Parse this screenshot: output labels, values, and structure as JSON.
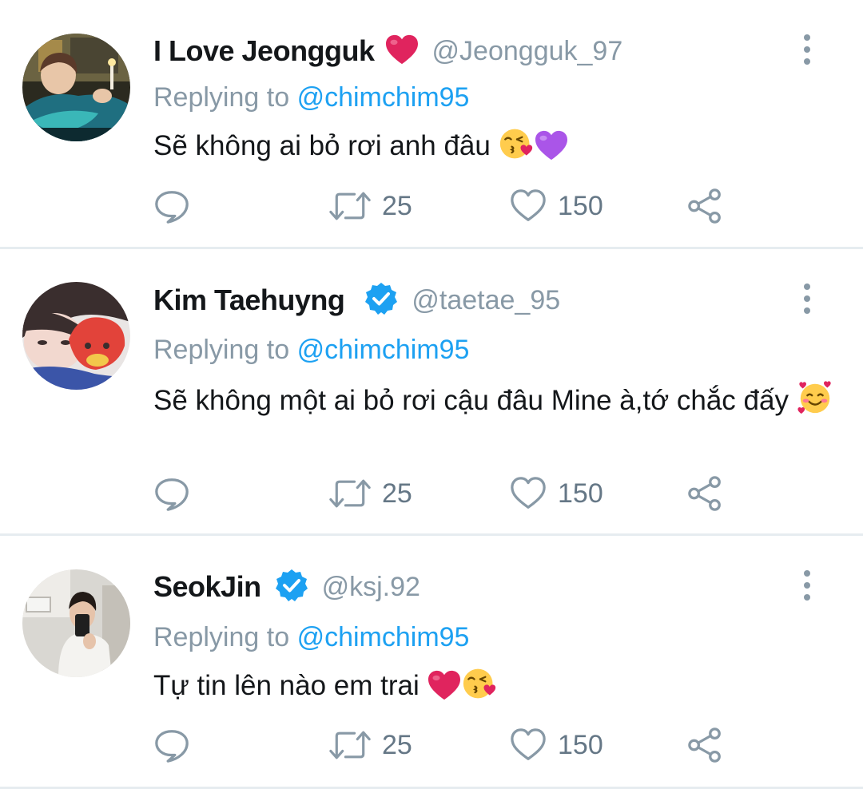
{
  "reply_prefix": "Replying to",
  "tweets": [
    {
      "name": "I Love Jeongguk",
      "name_icon": "red-heart",
      "handle": "@Jeongguk_97",
      "reply_to": "@chimchim95",
      "text": "Sẽ không ai bỏ rơi anh đâu",
      "emojis": [
        "kissing-face-with-heart",
        "purple-heart"
      ],
      "retweets": "25",
      "likes": "150",
      "verified": false
    },
    {
      "name": "Kim Taehuyng",
      "name_icon": "verified-badge",
      "handle": "@taetae_95",
      "reply_to": "@chimchim95",
      "text": "Sẽ không một ai bỏ rơi cậu đâu Mine à,tớ chắc đấy",
      "emojis": [
        "smiling-face-with-hearts"
      ],
      "retweets": "25",
      "likes": "150",
      "verified": true
    },
    {
      "name": "SeokJin",
      "name_icon": "verified-badge",
      "handle": "@ksj.92",
      "reply_to": "@chimchim95",
      "text": "Tự tin lên nào em trai",
      "emojis": [
        "red-heart",
        "kissing-face-with-heart"
      ],
      "retweets": "25",
      "likes": "150",
      "verified": true
    }
  ],
  "colors": {
    "link": "#1da1f2",
    "muted": "#8899a6",
    "verified": "#1da1f2",
    "heart": "#e0245e"
  }
}
